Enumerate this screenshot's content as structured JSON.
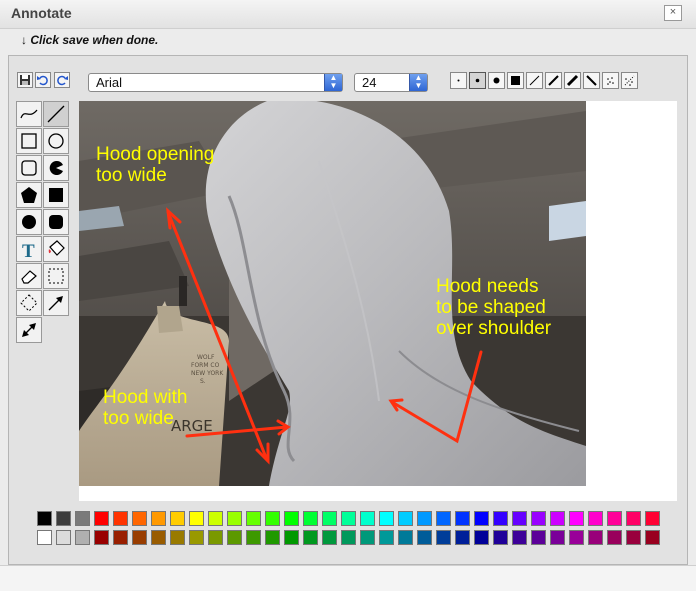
{
  "window": {
    "title": "Annotate",
    "close_glyph": "×"
  },
  "instruction": {
    "arrow": "↓",
    "text": "Click save when done."
  },
  "toolbar": {
    "file_buttons": [
      "save-icon",
      "undo-icon",
      "redo-icon"
    ],
    "font": {
      "value": "Arial"
    },
    "size": {
      "value": "24"
    },
    "brush_options": [
      "brush-dot-tiny",
      "brush-dot-small",
      "brush-dot-medium",
      "brush-square-large",
      "brush-line-thin",
      "brush-line-medium",
      "brush-line-thick",
      "brush-line-reverse",
      "brush-spray-small",
      "brush-spray-large"
    ],
    "active_brush": 1
  },
  "tools": [
    "freehand-icon",
    "line-icon",
    "rectangle-icon",
    "ellipse-icon",
    "rounded-rect-icon",
    "pie-icon",
    "filled-pentagon-icon",
    "filled-square-icon",
    "filled-circle-icon",
    "filled-rounded-rect-icon",
    "text-icon",
    "fill-bucket-icon",
    "eraser-icon",
    "rect-select-icon",
    "diamond-select-icon",
    "arrow-icon",
    "double-arrow-icon"
  ],
  "annotations": {
    "opening": "Hood opening\ntoo wide",
    "shoulder": "Hood needs\nto be shaped\nover shoulder",
    "with": "Hood with\ntoo wide"
  },
  "photo_background_text": {
    "form_text": "WOLF\nFORM CO\nNEW YORK\nS.",
    "form_word": "ARGE"
  },
  "annotation_color": "#ffff00",
  "arrow_color": "#ff3010",
  "palette": {
    "row1": [
      "#000000",
      "#3c3c3c",
      "#7a7a7a",
      "#ff0000",
      "#ff3300",
      "#ff6600",
      "#ff9900",
      "#ffcc00",
      "#ffff00",
      "#ccff00",
      "#99ff00",
      "#66ff00",
      "#33ff00",
      "#00ff00",
      "#00ff33",
      "#00ff66",
      "#00ff99",
      "#00ffcc",
      "#00ffff",
      "#00ccff",
      "#0099ff",
      "#0066ff",
      "#0033ff",
      "#0000ff",
      "#3300ff",
      "#6600ff",
      "#9900ff",
      "#cc00ff",
      "#ff00ff",
      "#ff00cc",
      "#ff0099",
      "#ff0066",
      "#ff0033"
    ],
    "row2": [
      "#ffffff",
      "#dcdcdc",
      "#b0b0b0",
      "#990000",
      "#991f00",
      "#993d00",
      "#995c00",
      "#997a00",
      "#999900",
      "#7a9900",
      "#5c9900",
      "#3d9900",
      "#1f9900",
      "#009900",
      "#00991f",
      "#00993d",
      "#00995c",
      "#00997a",
      "#009999",
      "#007a99",
      "#005c99",
      "#003d99",
      "#001f99",
      "#000099",
      "#1f0099",
      "#3d0099",
      "#5c0099",
      "#7a0099",
      "#990099",
      "#99007a",
      "#99005c",
      "#99003d",
      "#99001f"
    ]
  }
}
